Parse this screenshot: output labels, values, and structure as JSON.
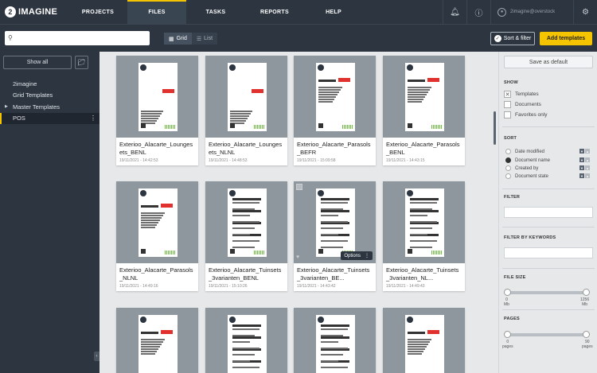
{
  "nav": {
    "logo": "IMAGINE",
    "logo_mark": "2",
    "items": [
      "PROJECTS",
      "FILES",
      "TASKS",
      "REPORTS",
      "HELP"
    ],
    "active": "FILES",
    "user": "2imagine@overstock"
  },
  "toolbar": {
    "search_placeholder": "",
    "view_grid": "Grid",
    "view_list": "List",
    "sort_filter": "Sort & filter",
    "add_templates": "Add templates"
  },
  "sidebar": {
    "show_all": "Show all",
    "items": [
      {
        "label": "2imagine"
      },
      {
        "label": "Grid Templates"
      },
      {
        "label": "Master Templates"
      },
      {
        "label": "POS"
      }
    ]
  },
  "cards": [
    {
      "name": "Exterioo_Alacarte_Loungesets_BENL",
      "date": "19/11/2021 - 14:42:53"
    },
    {
      "name": "Exterioo_Alacarte_Loungesets_NLNL",
      "date": "19/11/2021 - 14:48:53"
    },
    {
      "name": "Exterioo_Alacarte_Parasols_BEFR",
      "date": "19/11/2021 - 15:09:58"
    },
    {
      "name": "Exterioo_Alacarte_Parasols_BENL",
      "date": "19/11/2021 - 14:43:15"
    },
    {
      "name": "Exterioo_Alacarte_Parasols_NLNL",
      "date": "19/11/2021 - 14:49:16"
    },
    {
      "name": "Exterioo_Alacarte_Tuinsets_3varianten_BENL",
      "date": "19/11/2021 - 15:10:26"
    },
    {
      "name": "Exterioo_Alacarte_Tuinsets_3varianten_BE...",
      "date": "19/11/2021 - 14:43:42"
    },
    {
      "name": "Exterioo_Alacarte_Tuinsets_3varianten_NL...",
      "date": "19/11/2021 - 14:49:43"
    }
  ],
  "card_options": "Options",
  "panel": {
    "save_default": "Save as default",
    "show_title": "SHOW",
    "show": [
      {
        "label": "Templates",
        "checked": true
      },
      {
        "label": "Documents",
        "checked": false
      },
      {
        "label": "Favorites only",
        "checked": false
      }
    ],
    "sort_title": "SORT",
    "sort": [
      {
        "label": "Date modified",
        "selected": false
      },
      {
        "label": "Document name",
        "selected": true
      },
      {
        "label": "Created by",
        "selected": false
      },
      {
        "label": "Document state",
        "selected": false
      }
    ],
    "filter_title": "FILTER",
    "keywords_title": "FILTER BY KEYWORDS",
    "filesize_title": "FILE SIZE",
    "filesize_min": "0",
    "filesize_min_unit": "Mb",
    "filesize_max": "1256",
    "filesize_max_unit": "Mb",
    "pages_title": "PAGES",
    "pages_min": "0",
    "pages_min_unit": "pages",
    "pages_max": "90",
    "pages_max_unit": "pages"
  }
}
